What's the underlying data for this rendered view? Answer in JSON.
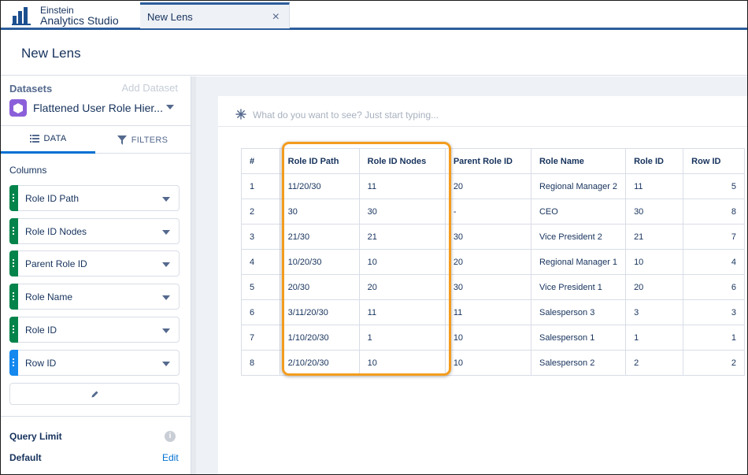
{
  "app": {
    "brand_line1": "Einstein",
    "brand_line2": "Analytics Studio"
  },
  "tab": {
    "label": "New Lens",
    "close_icon": "×"
  },
  "page": {
    "title": "New Lens"
  },
  "left_panel": {
    "datasets_label": "Datasets",
    "add_dataset_label": "Add Dataset",
    "selected_dataset": "Flattened User Role Hier...",
    "tabs": {
      "data": "DATA",
      "filters": "FILTERS"
    },
    "columns_label": "Columns",
    "columns": [
      {
        "name": "Role ID Path",
        "color": "#04844b"
      },
      {
        "name": "Role ID Nodes",
        "color": "#04844b"
      },
      {
        "name": "Parent Role ID",
        "color": "#04844b"
      },
      {
        "name": "Role Name",
        "color": "#04844b"
      },
      {
        "name": "Role ID",
        "color": "#04844b"
      },
      {
        "name": "Row ID",
        "color": "#1589ee"
      }
    ],
    "query_limit_label": "Query Limit",
    "default_label": "Default",
    "edit_label": "Edit"
  },
  "search": {
    "placeholder": "What do you want to see? Just start typing..."
  },
  "table": {
    "headers": [
      "#",
      "Role ID Path",
      "Role ID Nodes",
      "Parent Role ID",
      "Role Name",
      "Role ID",
      "Row ID"
    ],
    "rows": [
      [
        "1",
        "11/20/30",
        "11",
        "20",
        "Regional Manager 2",
        "11",
        "5"
      ],
      [
        "2",
        "30",
        "30",
        "-",
        "CEO",
        "30",
        "8"
      ],
      [
        "3",
        "21/30",
        "21",
        "30",
        "Vice President 2",
        "21",
        "7"
      ],
      [
        "4",
        "10/20/30",
        "10",
        "20",
        "Regional Manager 1",
        "10",
        "4"
      ],
      [
        "5",
        "20/30",
        "20",
        "30",
        "Vice President 1",
        "20",
        "6"
      ],
      [
        "6",
        "3/11/20/30",
        "11",
        "11",
        "Salesperson 3",
        "3",
        "3"
      ],
      [
        "7",
        "1/10/20/30",
        "1",
        "10",
        "Salesperson 1",
        "1",
        "1"
      ],
      [
        "8",
        "2/10/20/30",
        "10",
        "10",
        "Salesperson 2",
        "2",
        "2"
      ]
    ]
  },
  "colors": {
    "accent": "#2c5d9b",
    "highlight": "#f39c1f",
    "link": "#0070d2"
  }
}
